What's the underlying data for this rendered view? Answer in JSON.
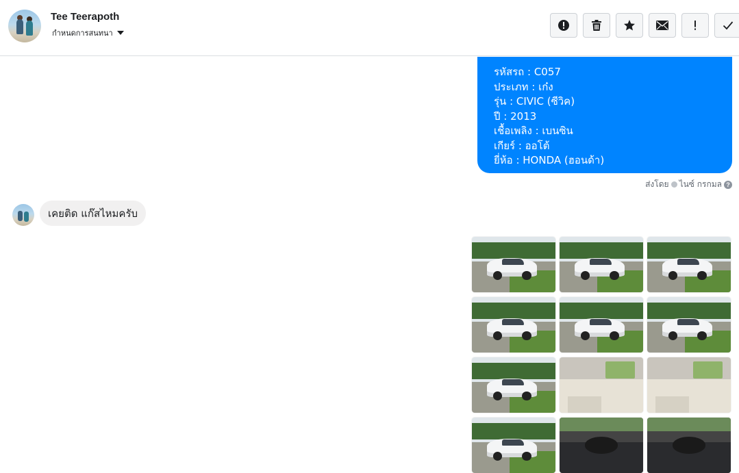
{
  "header": {
    "name": "Tee Teerapoth",
    "settings_label": "กำหนดการสนทนา",
    "toolbar": [
      {
        "id": "spam",
        "icon": "exclamation-circle-icon"
      },
      {
        "id": "delete",
        "icon": "trash-icon"
      },
      {
        "id": "star",
        "icon": "star-icon"
      },
      {
        "id": "unread",
        "icon": "envelope-icon"
      },
      {
        "id": "priority",
        "icon": "exclamation-icon"
      },
      {
        "id": "done",
        "icon": "check-icon"
      }
    ]
  },
  "messages": {
    "outgoing": {
      "lines": [
        "รหัสรถ : C057",
        "ประเภท : เก๋ง",
        "รุ่น : CIVIC (ซีวิค)",
        "ปี : 2013",
        "เชื้อเพลิง : เบนซิน",
        "เกียร์ : ออโต้",
        "ยี่ห้อ : HONDA (ฮอนด้า)"
      ],
      "sent_by_prefix": "ส่งโดย",
      "sent_by_name": "ไนซ์ กรกมล",
      "help": "?"
    },
    "incoming": {
      "text": "เคยติด แก๊สไหมครับ"
    }
  },
  "photos": [
    {
      "kind": "exterior"
    },
    {
      "kind": "exterior"
    },
    {
      "kind": "exterior"
    },
    {
      "kind": "exterior"
    },
    {
      "kind": "exterior"
    },
    {
      "kind": "exterior"
    },
    {
      "kind": "exterior"
    },
    {
      "kind": "interior"
    },
    {
      "kind": "interior"
    },
    {
      "kind": "exterior"
    },
    {
      "kind": "dash"
    },
    {
      "kind": "dash"
    }
  ],
  "colors": {
    "outgoing_bubble": "#0084ff",
    "incoming_bubble": "#f1f0f0",
    "toolbar_button_bg": "#f5f6f7"
  }
}
